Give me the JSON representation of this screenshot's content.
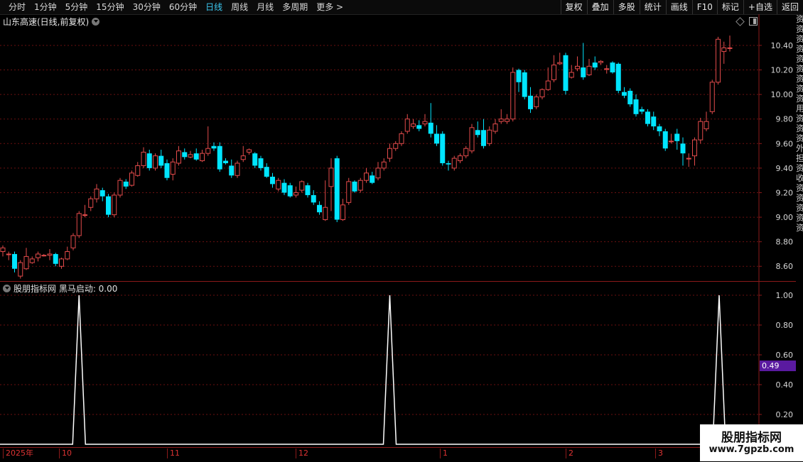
{
  "toolbar": {
    "periods": [
      "分时",
      "1分钟",
      "5分钟",
      "15分钟",
      "30分钟",
      "60分钟",
      "日线",
      "周线",
      "月线",
      "多周期",
      "更多 >"
    ],
    "active": "日线",
    "actions": [
      "复权",
      "叠加",
      "多股",
      "统计",
      "画线",
      "F10",
      "标记",
      "+自选",
      "返回"
    ]
  },
  "stock_title": "山东高速(日线,前复权)",
  "indicator_title": "股朋指标网 黑马启动: 0.00",
  "value_badge": "0.49",
  "watermark": {
    "line1": "股朋指标网",
    "line2": "www.7gpzb.com"
  },
  "right_strip": [
    "资",
    "资",
    "资",
    "资",
    "资",
    "资",
    "资",
    "资",
    "资",
    "用",
    "资",
    "资",
    "资",
    "外",
    "担",
    "资",
    "收",
    "资",
    "资",
    "资",
    "资",
    "资"
  ],
  "colors": {
    "up": "#e34b4b",
    "down": "#00e5ff",
    "grid": "#6b1111",
    "axis_text": "#d8d8d8",
    "indicator_line": "#ffffff"
  },
  "chart_data": [
    {
      "type": "candlestick",
      "title": "山东高速(日线,前复权)",
      "ylim": [
        8.48,
        10.55
      ],
      "y_ticks": [
        "10.40",
        "10.20",
        "10.00",
        "9.80",
        "9.60",
        "9.40",
        "9.20",
        "9.00",
        "8.80",
        "8.60"
      ],
      "x_labels": [
        "2025年",
        "10",
        "11",
        "12",
        "1",
        "2",
        "3"
      ],
      "candles": [
        [
          8.72,
          8.75,
          8.68,
          8.77
        ],
        [
          8.7,
          8.7,
          8.65,
          8.72
        ],
        [
          8.7,
          8.58,
          8.55,
          8.72
        ],
        [
          8.52,
          8.63,
          8.5,
          8.65
        ],
        [
          8.58,
          8.68,
          8.57,
          8.75
        ],
        [
          8.63,
          8.66,
          8.62,
          8.68
        ],
        [
          8.67,
          8.7,
          8.64,
          8.72
        ],
        [
          8.69,
          8.69,
          8.68,
          8.7
        ],
        [
          8.69,
          8.7,
          8.65,
          8.74
        ],
        [
          8.7,
          8.62,
          8.6,
          8.71
        ],
        [
          8.6,
          8.66,
          8.58,
          8.67
        ],
        [
          8.66,
          8.72,
          8.65,
          8.76
        ],
        [
          8.75,
          8.85,
          8.73,
          8.87
        ],
        [
          8.85,
          9.03,
          8.83,
          9.05
        ],
        [
          9.02,
          9.02,
          9.0,
          9.1
        ],
        [
          9.08,
          9.15,
          9.05,
          9.17
        ],
        [
          9.15,
          9.23,
          9.12,
          9.27
        ],
        [
          9.22,
          9.17,
          9.13,
          9.24
        ],
        [
          9.17,
          9.02,
          9.0,
          9.19
        ],
        [
          9.02,
          9.18,
          9.0,
          9.2
        ],
        [
          9.18,
          9.3,
          9.16,
          9.32
        ],
        [
          9.29,
          9.25,
          9.23,
          9.31
        ],
        [
          9.26,
          9.36,
          9.25,
          9.38
        ],
        [
          9.34,
          9.42,
          9.33,
          9.45
        ],
        [
          9.42,
          9.53,
          9.4,
          9.57
        ],
        [
          9.52,
          9.4,
          9.38,
          9.55
        ],
        [
          9.4,
          9.5,
          9.38,
          9.52
        ],
        [
          9.5,
          9.42,
          9.4,
          9.55
        ],
        [
          9.44,
          9.32,
          9.3,
          9.47
        ],
        [
          9.35,
          9.45,
          9.3,
          9.48
        ],
        [
          9.44,
          9.54,
          9.42,
          9.58
        ],
        [
          9.53,
          9.49,
          9.47,
          9.56
        ],
        [
          9.49,
          9.51,
          9.48,
          9.54
        ],
        [
          9.52,
          9.47,
          9.46,
          9.56
        ],
        [
          9.46,
          9.52,
          9.45,
          9.55
        ],
        [
          9.52,
          9.56,
          9.5,
          9.74
        ],
        [
          9.58,
          9.56,
          9.54,
          9.61
        ],
        [
          9.58,
          9.39,
          9.37,
          9.61
        ],
        [
          9.46,
          9.44,
          9.43,
          9.48
        ],
        [
          9.42,
          9.34,
          9.32,
          9.47
        ],
        [
          9.34,
          9.44,
          9.32,
          9.46
        ],
        [
          9.47,
          9.5,
          9.45,
          9.58
        ],
        [
          9.53,
          9.55,
          9.51,
          9.56
        ],
        [
          9.52,
          9.42,
          9.4,
          9.53
        ],
        [
          9.48,
          9.4,
          9.38,
          9.5
        ],
        [
          9.41,
          9.33,
          9.32,
          9.44
        ],
        [
          9.33,
          9.27,
          9.24,
          9.36
        ],
        [
          9.23,
          9.3,
          9.21,
          9.32
        ],
        [
          9.28,
          9.2,
          9.18,
          9.31
        ],
        [
          9.26,
          9.17,
          9.16,
          9.28
        ],
        [
          9.18,
          9.2,
          9.16,
          9.25
        ],
        [
          9.22,
          9.29,
          9.2,
          9.3
        ],
        [
          9.26,
          9.18,
          9.16,
          9.28
        ],
        [
          9.18,
          9.12,
          9.1,
          9.22
        ],
        [
          9.1,
          9.04,
          9.02,
          9.13
        ],
        [
          8.98,
          9.08,
          8.97,
          9.3
        ],
        [
          9.25,
          9.4,
          9.05,
          9.48
        ],
        [
          9.48,
          8.98,
          8.96,
          9.5
        ],
        [
          8.98,
          9.1,
          8.97,
          9.15
        ],
        [
          9.12,
          9.29,
          9.1,
          9.32
        ],
        [
          9.29,
          9.21,
          9.2,
          9.3
        ],
        [
          9.22,
          9.3,
          9.2,
          9.32
        ],
        [
          9.3,
          9.36,
          9.28,
          9.4
        ],
        [
          9.34,
          9.28,
          9.27,
          9.37
        ],
        [
          9.32,
          9.4,
          9.3,
          9.45
        ],
        [
          9.4,
          9.45,
          9.38,
          9.48
        ],
        [
          9.48,
          9.56,
          9.45,
          9.6
        ],
        [
          9.56,
          9.6,
          9.54,
          9.62
        ],
        [
          9.6,
          9.68,
          9.58,
          9.7
        ],
        [
          9.7,
          9.8,
          9.68,
          9.84
        ],
        [
          9.74,
          9.76,
          9.72,
          9.8
        ],
        [
          9.75,
          9.72,
          9.7,
          9.79
        ],
        [
          9.76,
          9.78,
          9.74,
          9.84
        ],
        [
          9.77,
          9.68,
          9.65,
          9.93
        ],
        [
          9.68,
          9.6,
          9.58,
          9.75
        ],
        [
          9.68,
          9.44,
          9.42,
          9.7
        ],
        [
          9.44,
          9.43,
          9.38,
          9.46
        ],
        [
          9.4,
          9.48,
          9.38,
          9.5
        ],
        [
          9.46,
          9.5,
          9.44,
          9.52
        ],
        [
          9.5,
          9.56,
          9.48,
          9.58
        ],
        [
          9.54,
          9.73,
          9.52,
          9.76
        ],
        [
          9.71,
          9.67,
          9.65,
          9.78
        ],
        [
          9.71,
          9.58,
          9.56,
          9.8
        ],
        [
          9.6,
          9.71,
          9.58,
          9.74
        ],
        [
          9.7,
          9.76,
          9.68,
          9.8
        ],
        [
          9.78,
          9.8,
          9.76,
          9.88
        ],
        [
          9.78,
          9.8,
          9.76,
          9.84
        ],
        [
          9.8,
          10.18,
          9.78,
          10.22
        ],
        [
          10.2,
          10.1,
          10.02,
          10.21
        ],
        [
          10.18,
          9.98,
          9.96,
          10.2
        ],
        [
          9.99,
          9.88,
          9.85,
          10.06
        ],
        [
          9.9,
          9.98,
          9.88,
          10.0
        ],
        [
          9.98,
          10.04,
          9.96,
          10.05
        ],
        [
          10.04,
          10.11,
          10.03,
          10.22
        ],
        [
          10.12,
          10.24,
          10.1,
          10.32
        ],
        [
          10.25,
          10.26,
          10.24,
          10.34
        ],
        [
          10.32,
          10.03,
          10.0,
          10.34
        ],
        [
          10.14,
          10.18,
          10.13,
          10.24
        ],
        [
          10.21,
          10.23,
          10.19,
          10.31
        ],
        [
          10.22,
          10.14,
          10.12,
          10.42
        ],
        [
          10.16,
          10.23,
          10.15,
          10.29
        ],
        [
          10.26,
          10.22,
          10.2,
          10.31
        ],
        [
          10.26,
          10.27,
          10.24,
          10.28
        ],
        [
          10.21,
          10.21,
          10.17,
          10.24
        ],
        [
          10.26,
          10.18,
          10.17,
          10.27
        ],
        [
          10.25,
          10.03,
          10.01,
          10.26
        ],
        [
          10.02,
          9.99,
          9.97,
          10.06
        ],
        [
          10.03,
          9.92,
          9.9,
          10.05
        ],
        [
          9.96,
          9.84,
          9.82,
          10.0
        ],
        [
          9.88,
          9.86,
          9.84,
          9.9
        ],
        [
          9.86,
          9.76,
          9.74,
          9.88
        ],
        [
          9.82,
          9.74,
          9.71,
          9.86
        ],
        [
          9.74,
          9.7,
          9.66,
          9.76
        ],
        [
          9.7,
          9.56,
          9.54,
          9.72
        ],
        [
          9.62,
          9.62,
          9.6,
          9.68
        ],
        [
          9.68,
          9.62,
          9.55,
          9.72
        ],
        [
          9.6,
          9.52,
          9.42,
          9.65
        ],
        [
          9.48,
          9.48,
          9.41,
          9.52
        ],
        [
          9.5,
          9.63,
          9.42,
          9.65
        ],
        [
          9.63,
          9.78,
          9.6,
          9.81
        ],
        [
          9.72,
          9.78,
          9.7,
          9.86
        ],
        [
          9.86,
          10.1,
          9.84,
          10.12
        ],
        [
          10.1,
          10.45,
          10.08,
          10.47
        ],
        [
          10.35,
          10.38,
          10.25,
          10.43
        ],
        [
          10.38,
          10.38,
          10.35,
          10.48
        ]
      ]
    },
    {
      "type": "line",
      "title": "股朋指标网 黑马启动: 0.00",
      "ylim": [
        0,
        1.0
      ],
      "y_ticks": [
        "1.00",
        "0.80",
        "0.60",
        "0.40",
        "0.20"
      ],
      "series": [
        {
          "name": "黑马启动",
          "signal_indices": [
            13,
            66,
            125
          ],
          "values_note": ""
        }
      ]
    }
  ]
}
